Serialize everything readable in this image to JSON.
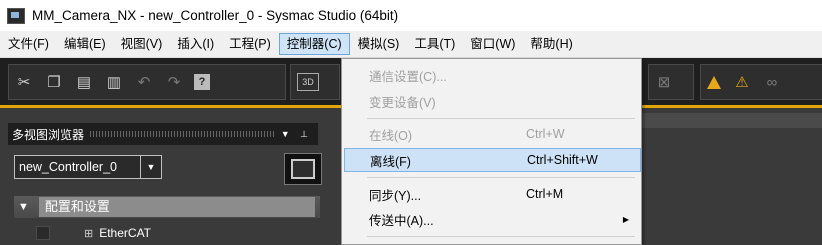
{
  "window": {
    "title": "MM_Camera_NX - new_Controller_0 - Sysmac Studio (64bit)"
  },
  "menubar": {
    "items": [
      {
        "label": "文件(F)"
      },
      {
        "label": "编辑(E)"
      },
      {
        "label": "视图(V)"
      },
      {
        "label": "插入(I)"
      },
      {
        "label": "工程(P)"
      },
      {
        "label": "控制器(C)",
        "active": true
      },
      {
        "label": "模拟(S)"
      },
      {
        "label": "工具(T)"
      },
      {
        "label": "窗口(W)"
      },
      {
        "label": "帮助(H)"
      }
    ]
  },
  "toolbar": {
    "icons": [
      "cut-icon",
      "copy-icon",
      "paste-icon",
      "delete-icon",
      "undo-icon",
      "redo-icon",
      "help-icon",
      "3d-icon",
      "controller-icon",
      "warning-icon",
      "warning-off-icon",
      "link-icon"
    ],
    "label_3d": "3D",
    "label_help": "?",
    "accent_color": "#e3a60a"
  },
  "left_pane": {
    "title": "多视图浏览器",
    "controller_select": {
      "value": "new_Controller_0"
    },
    "tree": {
      "section_label": "配置和设置",
      "items": [
        {
          "label": "EtherCAT"
        }
      ]
    }
  },
  "controller_menu": {
    "items": [
      {
        "label": "通信设置(C)...",
        "shortcut": "",
        "disabled": true
      },
      {
        "label": "变更设备(V)",
        "shortcut": "",
        "disabled": true
      },
      {
        "label": "在线(O)",
        "shortcut": "Ctrl+W",
        "disabled": true
      },
      {
        "label": "离线(F)",
        "shortcut": "Ctrl+Shift+W",
        "disabled": false,
        "hover": true
      },
      {
        "label": "同步(Y)...",
        "shortcut": "Ctrl+M",
        "disabled": false
      },
      {
        "label": "传送中(A)...",
        "shortcut": "",
        "disabled": false,
        "submenu": true
      }
    ]
  }
}
